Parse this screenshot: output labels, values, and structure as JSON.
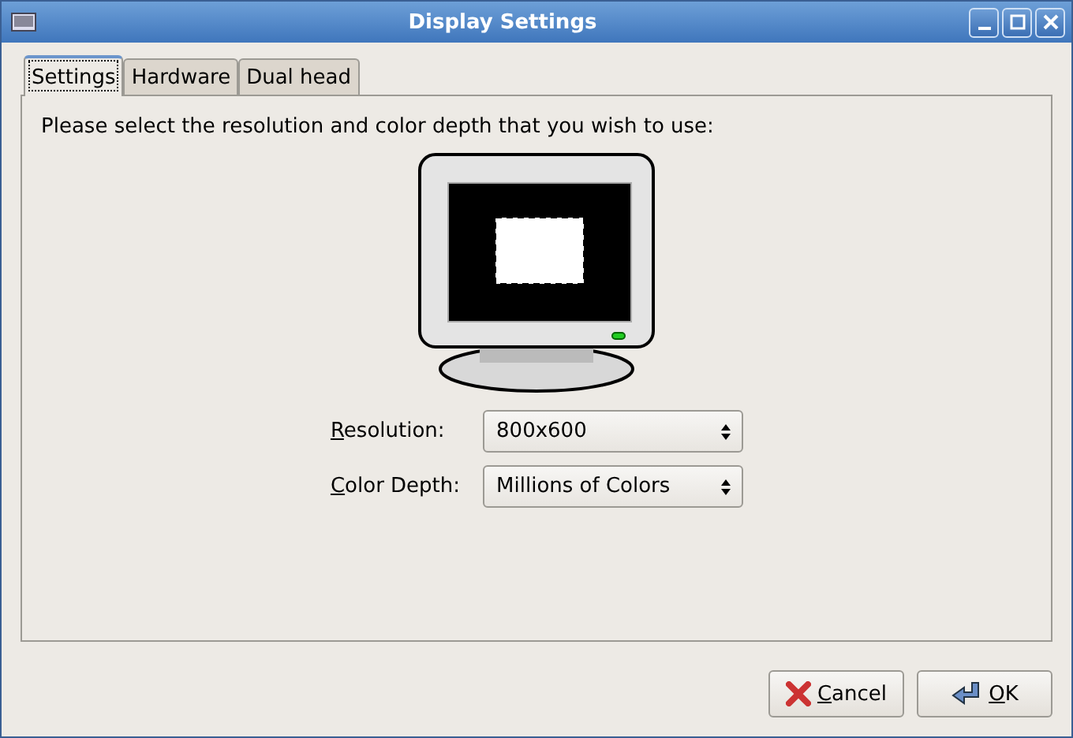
{
  "window": {
    "title": "Display Settings"
  },
  "tabs": [
    {
      "label": "Settings",
      "selected": true
    },
    {
      "label": "Hardware",
      "selected": false
    },
    {
      "label": "Dual head",
      "selected": false
    }
  ],
  "instruction": "Please select the resolution and color depth that you wish to use:",
  "fields": [
    {
      "label": "Resolution:",
      "value": "800x600"
    },
    {
      "label": "Color Depth:",
      "value": "Millions of Colors"
    }
  ],
  "buttons": [
    {
      "label": "Cancel",
      "kind": "cancel"
    },
    {
      "label": "OK",
      "kind": "ok"
    }
  ]
}
